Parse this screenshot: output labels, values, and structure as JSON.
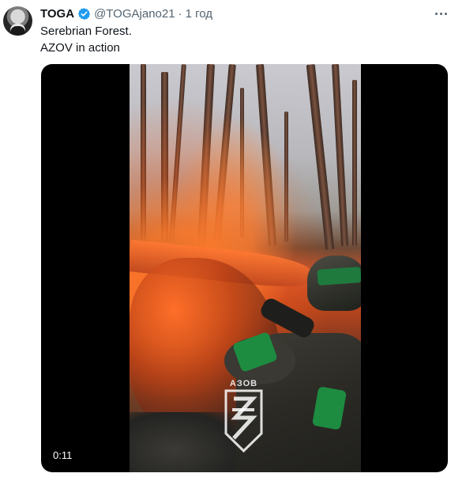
{
  "tweet": {
    "author_name": "TOGA",
    "handle": "@TOGAjano21",
    "separator": "·",
    "time": "1 год",
    "text_lines": [
      "Serebrian Forest.",
      "AZOV in action"
    ]
  },
  "media": {
    "duration": "0:11",
    "logo_text": "АЗОВ"
  },
  "icons": {
    "verified": "verified-badge-icon",
    "more": "more-options-icon"
  },
  "colors": {
    "verified_blue": "#1d9bf0",
    "secondary_text": "#536471",
    "primary_text": "#0f1419"
  }
}
